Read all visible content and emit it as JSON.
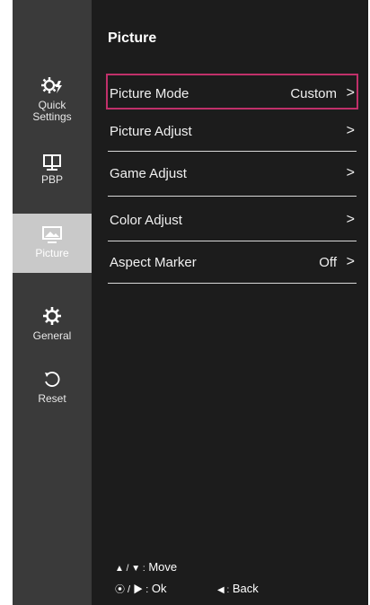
{
  "sidebar": {
    "items": [
      {
        "label": "Quick\nSettings",
        "icon": "quick-settings-icon"
      },
      {
        "label": "PBP",
        "icon": "pbp-icon"
      },
      {
        "label": "Picture",
        "icon": "picture-icon"
      },
      {
        "label": "General",
        "icon": "gear-icon"
      },
      {
        "label": "Reset",
        "icon": "reset-icon"
      }
    ]
  },
  "main": {
    "title": "Picture",
    "menu": [
      {
        "label": "Picture Mode",
        "value": "Custom",
        "chevron": ">"
      },
      {
        "label": "Picture Adjust",
        "value": "",
        "chevron": ">"
      },
      {
        "label": "Game Adjust",
        "value": "",
        "chevron": ">"
      },
      {
        "label": "Color Adjust",
        "value": "",
        "chevron": ">"
      },
      {
        "label": "Aspect Marker",
        "value": "Off",
        "chevron": ">"
      }
    ]
  },
  "hints": {
    "move": "Move",
    "ok": "Ok",
    "back": "Back"
  },
  "colors": {
    "panel": "#1c1c1c",
    "sidebar": "#3a3a3a",
    "sidebar_active": "#c9c9c9",
    "selection": "#c0306a"
  }
}
